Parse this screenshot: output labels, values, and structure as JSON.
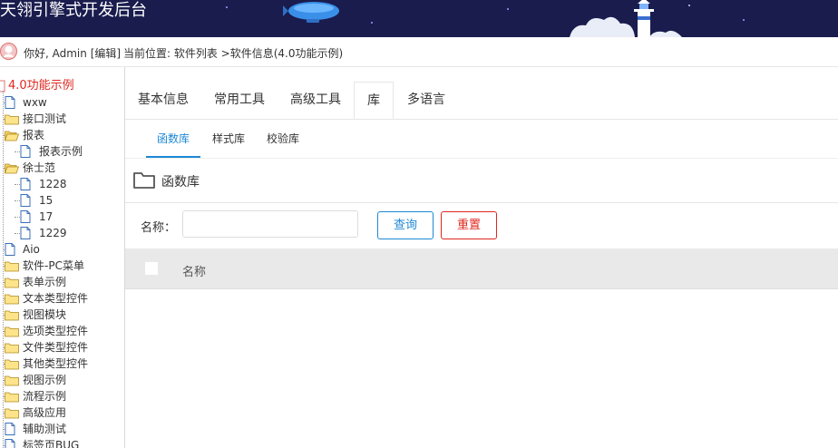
{
  "header": {
    "title": "天翎引擎式开发后台"
  },
  "userbar": {
    "greeting": "你好, Admin [编辑]",
    "breadcrumb": "当前位置: 软件列表 >软件信息(4.0功能示例)"
  },
  "sidebar": {
    "root": "4.0功能示例",
    "items": [
      {
        "label": "wxw",
        "type": "file",
        "level": 1
      },
      {
        "label": "接口测试",
        "type": "folder",
        "level": 1
      },
      {
        "label": "报表",
        "type": "folder-open",
        "level": 1
      },
      {
        "label": "报表示例",
        "type": "file",
        "level": 2
      },
      {
        "label": "徐士范",
        "type": "folder-open",
        "level": 1
      },
      {
        "label": "1228",
        "type": "file",
        "level": 2
      },
      {
        "label": "15",
        "type": "file",
        "level": 2
      },
      {
        "label": "17",
        "type": "file",
        "level": 2
      },
      {
        "label": "1229",
        "type": "file",
        "level": 2
      },
      {
        "label": "Aio",
        "type": "file",
        "level": 1
      },
      {
        "label": "软件-PC菜单",
        "type": "folder",
        "level": 1
      },
      {
        "label": "表单示例",
        "type": "folder",
        "level": 1
      },
      {
        "label": "文本类型控件",
        "type": "folder",
        "level": 1
      },
      {
        "label": "视图模块",
        "type": "folder",
        "level": 1
      },
      {
        "label": "选项类型控件",
        "type": "folder",
        "level": 1
      },
      {
        "label": "文件类型控件",
        "type": "folder",
        "level": 1
      },
      {
        "label": "其他类型控件",
        "type": "folder",
        "level": 1
      },
      {
        "label": "视图示例",
        "type": "folder",
        "level": 1
      },
      {
        "label": "流程示例",
        "type": "folder",
        "level": 1
      },
      {
        "label": "高级应用",
        "type": "folder",
        "level": 1
      },
      {
        "label": "辅助测试",
        "type": "file",
        "level": 1
      },
      {
        "label": "标签页BUG",
        "type": "file",
        "level": 1
      }
    ]
  },
  "tabs": [
    {
      "label": "基本信息"
    },
    {
      "label": "常用工具"
    },
    {
      "label": "高级工具"
    },
    {
      "label": "库",
      "active": true
    },
    {
      "label": "多语言"
    }
  ],
  "subtabs": [
    {
      "label": "函数库",
      "active": true
    },
    {
      "label": "样式库"
    },
    {
      "label": "校验库"
    }
  ],
  "section": {
    "title": "函数库"
  },
  "search": {
    "label": "名称：",
    "value": "",
    "query_label": "查询",
    "reset_label": "重置"
  },
  "grid": {
    "columns": [
      "名称"
    ]
  },
  "colors": {
    "header_bg": "#1a1c4e",
    "accent": "#1e88d6",
    "danger": "#e0271f",
    "root_text": "#e0271f"
  }
}
